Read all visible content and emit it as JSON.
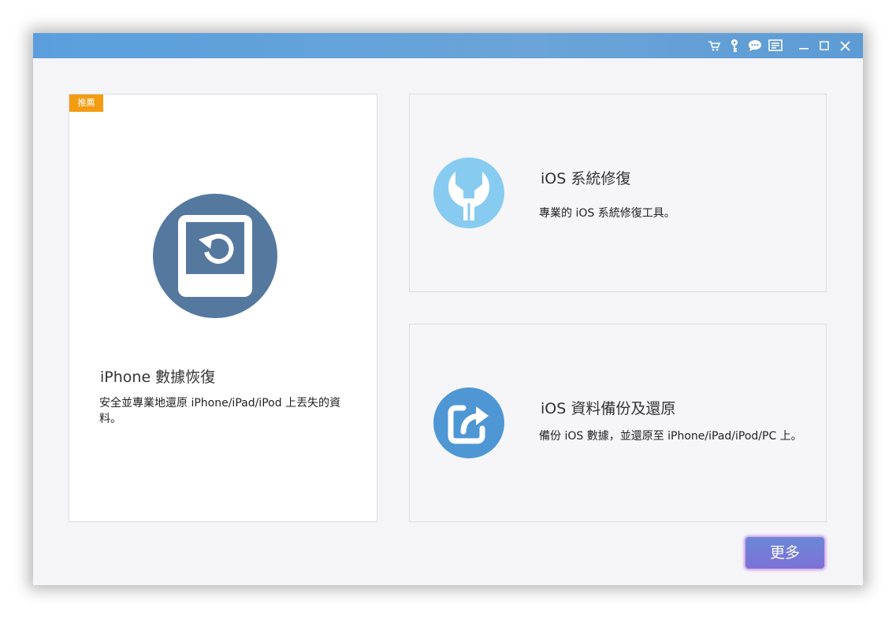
{
  "titlebar": {
    "icons": [
      "cart-icon",
      "key-icon",
      "chat-icon",
      "menu-icon",
      "minimize-icon",
      "maximize-icon",
      "close-icon"
    ]
  },
  "cards": {
    "iphone_recovery": {
      "badge": "推薦",
      "title": "iPhone 數據恢復",
      "description": "安全並專業地還原 iPhone/iPad/iPod 上丟失的資料。",
      "icon": "device-restore-icon"
    },
    "ios_system_repair": {
      "title": "iOS 系統修復",
      "description": "專業的 iOS 系統修復工具。",
      "icon": "wrench-icon"
    },
    "ios_backup_restore": {
      "title": "iOS 資料備份及還原",
      "description": "備份 iOS 數據，並還原至 iPhone/iPad/iPod/PC 上。",
      "icon": "backup-share-icon"
    }
  },
  "more_button": {
    "label": "更多"
  },
  "colors": {
    "titlebar": "#5d9bd5",
    "badge": "#f39c12",
    "recovery_circle": "#55789f",
    "repair_circle": "#87cbf1",
    "backup_circle": "#4f97d4",
    "more_button": "#6a88d6"
  }
}
